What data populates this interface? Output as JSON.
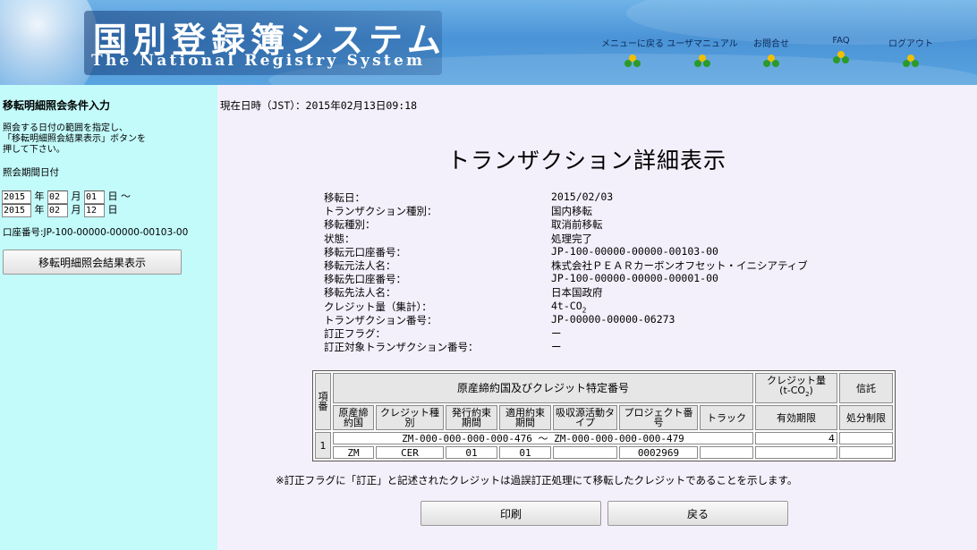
{
  "header": {
    "logo_ja": "国別登録簿システム",
    "logo_en": "The National Registry System",
    "nav": [
      {
        "label": "メニューに戻る"
      },
      {
        "label": "ユーザマニュアル"
      },
      {
        "label": "お問合せ"
      },
      {
        "label": "FAQ"
      },
      {
        "label": "ログアウト"
      }
    ]
  },
  "sidebar": {
    "title": "移転明細照会条件入力",
    "description_lines": [
      "照会する日付の範囲を指定し、",
      "「移転明細照会結果表示」ボタンを",
      "押して下さい。"
    ],
    "period_label": "照会期間日付",
    "from": {
      "year": "2015",
      "month": "02",
      "day": "01",
      "year_unit": "年",
      "month_unit": "月",
      "day_unit": "日",
      "tilde": "～"
    },
    "to": {
      "year": "2015",
      "month": "02",
      "day": "12",
      "year_unit": "年",
      "month_unit": "月",
      "day_unit": "日"
    },
    "account": "口座番号:JP-100-00000-00000-00103-00",
    "button_label": "移転明細照会結果表示"
  },
  "main": {
    "datetime": "現在日時（JST）：2015年02月13日09:18",
    "title": "トランザクション詳細表示",
    "details": [
      {
        "label": "移転日：",
        "value": "2015/02/03"
      },
      {
        "label": "トランザクション種別：",
        "value": "国内移転"
      },
      {
        "label": "移転種別：",
        "value": "取消前移転"
      },
      {
        "label": "状態：",
        "value": "処理完了"
      },
      {
        "label": "移転元口座番号：",
        "value": "JP-100-00000-00000-00103-00"
      },
      {
        "label": "移転元法人名：",
        "value": "株式会社ＰＥＡＲカーボンオフセット・イニシアティブ"
      },
      {
        "label": "移転先口座番号：",
        "value": "JP-100-00000-00000-00001-00"
      },
      {
        "label": "移転先法人名：",
        "value": "日本国政府"
      },
      {
        "label": "クレジット量（集計）：",
        "value": "4t-CO",
        "sub": "2"
      },
      {
        "label": "トランザクション番号：",
        "value": "JP-00000-00000-06273"
      },
      {
        "label": "訂正フラグ：",
        "value": "ー"
      },
      {
        "label": "訂正対象トランザクション番号：",
        "value": "ー"
      }
    ],
    "table": {
      "h_item": "項番",
      "h_group": "原産締約国及びクレジット特定番号",
      "h_credit": "クレジット量",
      "h_credit_unit": "(t-CO",
      "h_credit_unit_sub": "2",
      "h_credit_unit_end": ")",
      "h_trust": "信託",
      "sub_headers": [
        "原産締約国",
        "クレジット種別",
        "発行約束期間",
        "適用約束期間",
        "吸収源活動タイプ",
        "プロジェクト番号",
        "トラック",
        "有効期限",
        "処分制限"
      ],
      "rows": [
        {
          "no": "1",
          "range": "ZM-000-000-000-000-476 ～ ZM-000-000-000-000-479",
          "amount": "4",
          "country": "ZM",
          "type": "CER",
          "issue_period": "01",
          "apply_period": "01",
          "sink_type": "",
          "project": "0002969",
          "track": "",
          "expiry": "",
          "restriction": ""
        }
      ]
    },
    "note": "※訂正フラグに「訂正」と記述されたクレジットは過誤訂正処理にて移転したクレジットであることを示します。",
    "print_label": "印刷",
    "back_label": "戻る"
  }
}
